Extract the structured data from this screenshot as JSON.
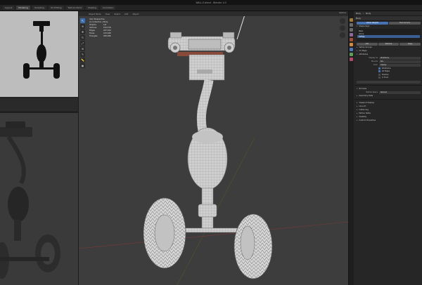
{
  "window": {
    "title": "WALL-E.blend - Blender 4.0"
  },
  "menubar": {
    "tabs": [
      "Layout",
      "Modeling",
      "Sculpting",
      "UV Editing",
      "Texture Paint",
      "Shading",
      "Animation"
    ],
    "active_index": 1
  },
  "viewport": {
    "header": [
      "Object Mode",
      "View",
      "Select",
      "Add",
      "Object"
    ],
    "options_label": "Options",
    "stats": [
      {
        "k": "Objects",
        "v": "1/6"
      },
      {
        "k": "Vertices",
        "v": "104,578"
      },
      {
        "k": "Edges",
        "v": "207,320"
      },
      {
        "k": "Faces",
        "v": "103,048"
      },
      {
        "k": "Triangles",
        "v": "206,096"
      }
    ],
    "stats_title": "User Perspective",
    "stats_sub": "(1) Collection | Body"
  },
  "properties": {
    "header_object": "Body",
    "header_data": "Body",
    "sections": {
      "shape_keys": "Shape Keys",
      "vertex_groups": "Vertex Groups",
      "uv_maps": "UV Maps",
      "attributes": "Attributes",
      "normals": "Normals",
      "texture_space": "Texture Space",
      "remesh": "Remesh",
      "geometry_data": "Geometry Data",
      "custom_properties": "Custom Properties"
    },
    "mode_buttons": [
      "Vertex Weights",
      "Face Corners"
    ],
    "list_items": [
      "Basis",
      "Group",
      "UVMap"
    ],
    "op_buttons": [
      "Add",
      "Remove",
      "Apply"
    ],
    "fields": [
      {
        "lab": "Display As",
        "val": "Wireframe"
      },
      {
        "lab": "Bounds",
        "val": "Box"
      },
      {
        "lab": "Color",
        "val": "Display"
      }
    ],
    "checks": [
      {
        "label": "Wireframe",
        "on": true
      },
      {
        "label": "All Edges",
        "on": true
      },
      {
        "label": "Shadow",
        "on": false
      },
      {
        "label": "In Front",
        "on": false
      }
    ],
    "collapsed": [
      "Viewport Display",
      "Line Art",
      "Instancing",
      "Motion Paths",
      "Visibility"
    ]
  },
  "colors": {
    "accent": "#4772b3",
    "viewport": "#3d3d3d",
    "panel": "#262626",
    "mesh": "#d2d2d2"
  }
}
